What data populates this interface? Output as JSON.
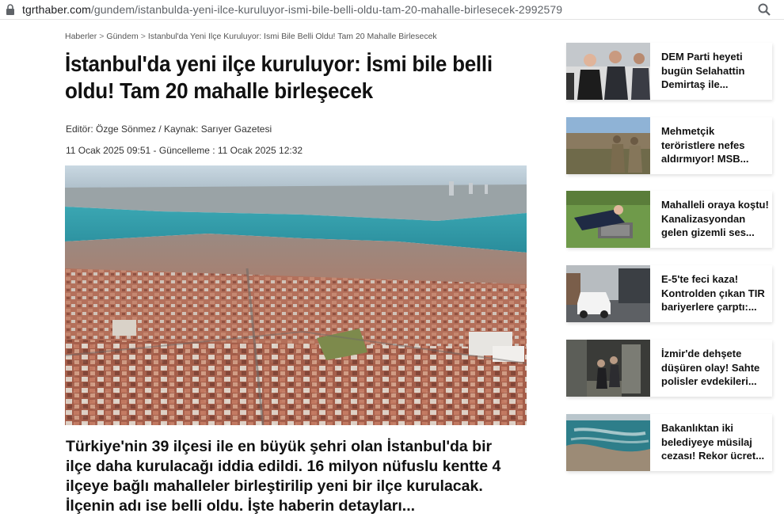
{
  "browser": {
    "url_host": "tgrthaber.com",
    "url_path": "/gundem/istanbulda-yeni-ilce-kuruluyor-ismi-bile-belli-oldu-tam-20-mahalle-birlesecek-2992579"
  },
  "breadcrumb": {
    "items": [
      "Haberler",
      "Gündem",
      "Istanbul'da Yeni Ilçe Kuruluyor: Ismi Bile Belli Oldu! Tam 20 Mahalle Birlesecek"
    ],
    "separator": ">"
  },
  "article": {
    "title": "İstanbul'da yeni ilçe kuruluyor: İsmi bile belli oldu! Tam 20 mahalle birleşecek",
    "editor_line": "Editör: Özge Sönmez / Kaynak: Sarıyer Gazetesi",
    "date_line": "11 Ocak 2025 09:51 - Güncelleme : 11 Ocak 2025 12:32",
    "summary": "Türkiye'nin 39 ilçesi ile en büyük şehri olan İstanbul'da bir ilçe daha kurulacağı iddia edildi. 16 milyon nüfuslu kentte 4 ilçeye bağlı mahalleler birleştirilip yeni bir ilçe kurulacak. İlçenin adı ise belli oldu. İşte haberin detayları..."
  },
  "sidebar": {
    "items": [
      {
        "title": "DEM Parti heyeti bugün Selahattin Demirtaş ile..."
      },
      {
        "title": "Mehmetçik teröristlere nefes aldırmıyor! MSB..."
      },
      {
        "title": "Mahalleli oraya koştu! Kanalizasyondan gelen gizemli ses..."
      },
      {
        "title": "E-5'te feci kaza! Kontrolden çıkan TIR bariyerlere çarptı:..."
      },
      {
        "title": "İzmir'de dehşete düşüren olay! Sahte polisler evdekileri..."
      },
      {
        "title": "Bakanlıktan iki belediyeye müsilaj cezası! Rekor ücret..."
      }
    ]
  },
  "icons": {
    "lock": "lock-icon",
    "zoom": "search-icon"
  },
  "colors": {
    "sea": "#2f9aa8",
    "roofs": "#b8705a",
    "text": "#111111"
  }
}
